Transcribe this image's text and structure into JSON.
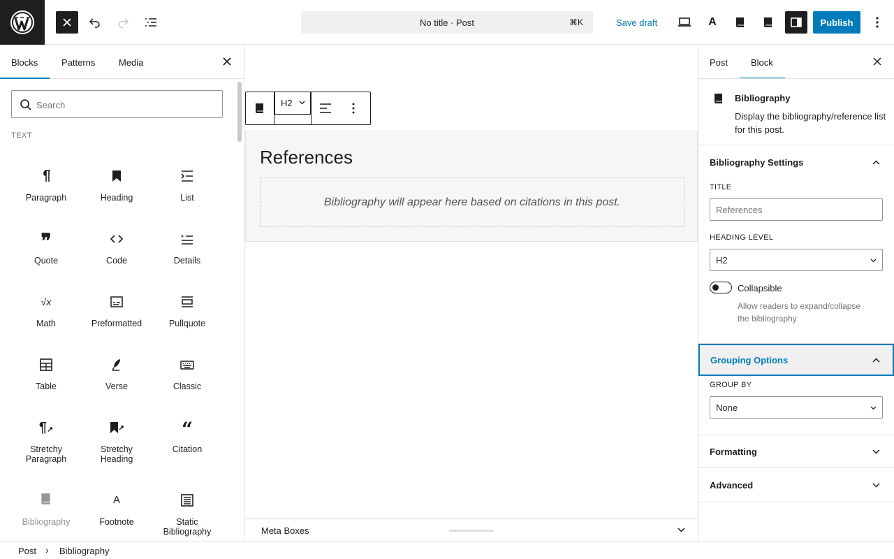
{
  "topbar": {
    "command_title": "No title · Post",
    "command_shortcut": "⌘K",
    "save_draft_label": "Save draft",
    "publish_label": "Publish"
  },
  "inserter": {
    "tabs": [
      "Blocks",
      "Patterns",
      "Media"
    ],
    "search_placeholder": "Search",
    "category": "TEXT",
    "blocks": [
      {
        "label": "Paragraph",
        "icon": "paragraph-icon"
      },
      {
        "label": "Heading",
        "icon": "heading-icon"
      },
      {
        "label": "List",
        "icon": "list-icon"
      },
      {
        "label": "Quote",
        "icon": "quote-icon"
      },
      {
        "label": "Code",
        "icon": "code-icon"
      },
      {
        "label": "Details",
        "icon": "details-icon"
      },
      {
        "label": "Math",
        "icon": "math-icon"
      },
      {
        "label": "Preformatted",
        "icon": "preformatted-icon"
      },
      {
        "label": "Pullquote",
        "icon": "pullquote-icon"
      },
      {
        "label": "Table",
        "icon": "table-icon"
      },
      {
        "label": "Verse",
        "icon": "verse-icon"
      },
      {
        "label": "Classic",
        "icon": "classic-icon"
      },
      {
        "label": "Stretchy Paragraph",
        "icon": "stretchy-paragraph-icon"
      },
      {
        "label": "Stretchy Heading",
        "icon": "stretchy-heading-icon"
      },
      {
        "label": "Citation",
        "icon": "citation-icon"
      },
      {
        "label": "Bibliography",
        "icon": "bibliography-icon"
      },
      {
        "label": "Footnote",
        "icon": "footnote-icon"
      },
      {
        "label": "Static Bibliography",
        "icon": "static-bibliography-icon"
      }
    ]
  },
  "canvas": {
    "toolbar_heading_level": "H2",
    "block_title": "References",
    "placeholder_text": "Bibliography will appear here based on citations in this post.",
    "meta_boxes_label": "Meta Boxes"
  },
  "sidebar": {
    "tabs": [
      "Post",
      "Block"
    ],
    "block_name": "Bibliography",
    "block_description": "Display the bibliography/reference list for this post.",
    "settings_title": "Bibliography Settings",
    "title_label": "TITLE",
    "title_placeholder": "References",
    "heading_level_label": "HEADING LEVEL",
    "heading_level_value": "H2",
    "collapsible_label": "Collapsible",
    "collapsible_help": "Allow readers to expand/collapse the bibliography",
    "grouping_title": "Grouping Options",
    "group_by_label": "GROUP BY",
    "group_by_value": "None",
    "formatting_title": "Formatting",
    "advanced_title": "Advanced"
  },
  "breadcrumb": [
    "Post",
    "Bibliography"
  ],
  "colors": {
    "accent": "#007cba",
    "dark": "#1e1e1e",
    "muted": "#757575"
  }
}
